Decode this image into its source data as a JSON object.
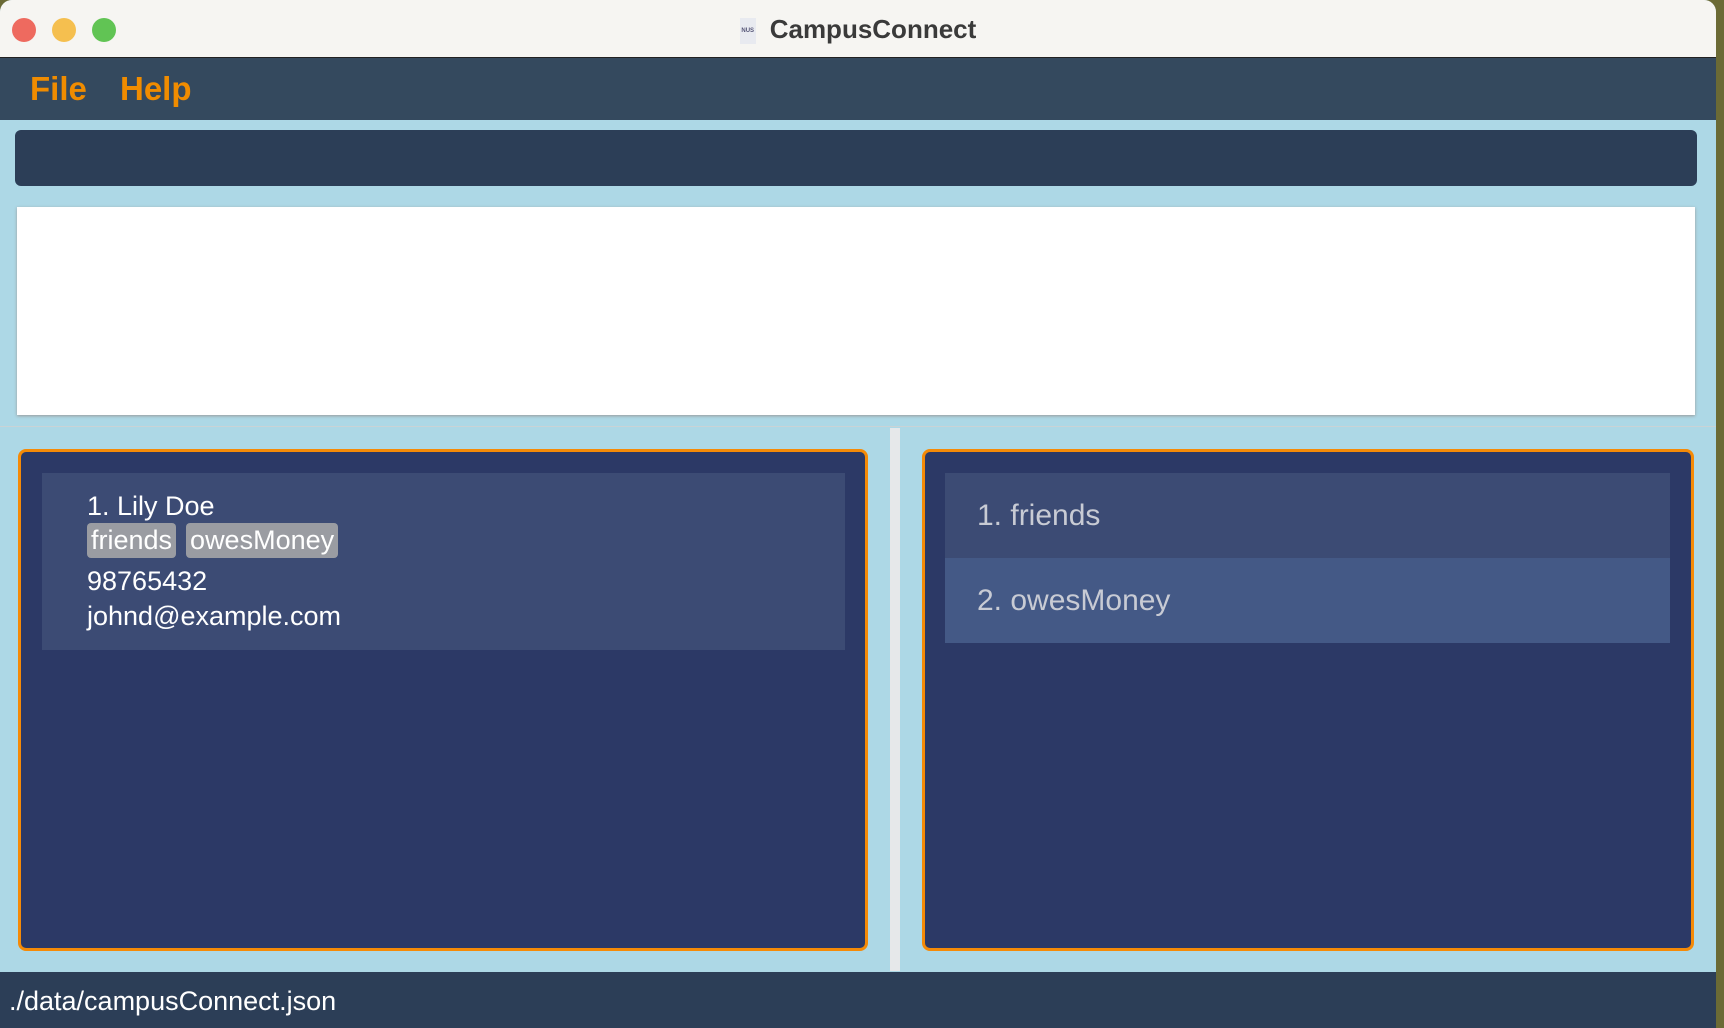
{
  "window": {
    "title": "CampusConnect",
    "icon": "nus-logo"
  },
  "menu": {
    "file": "File",
    "help": "Help"
  },
  "command_box": {
    "value": ""
  },
  "result_display": {
    "text": ""
  },
  "person_list": [
    {
      "index_name": "1. Lily Doe",
      "tags": [
        "friends",
        "owesMoney"
      ],
      "phone": "98765432",
      "email": "johnd@example.com"
    }
  ],
  "tag_list": [
    "1. friends",
    "2. owesMoney"
  ],
  "status_bar": {
    "path": "./data/campusConnect.json"
  },
  "colors": {
    "accent": "#f58a07",
    "panel": "#2c3966",
    "card": "#3c4b74"
  }
}
